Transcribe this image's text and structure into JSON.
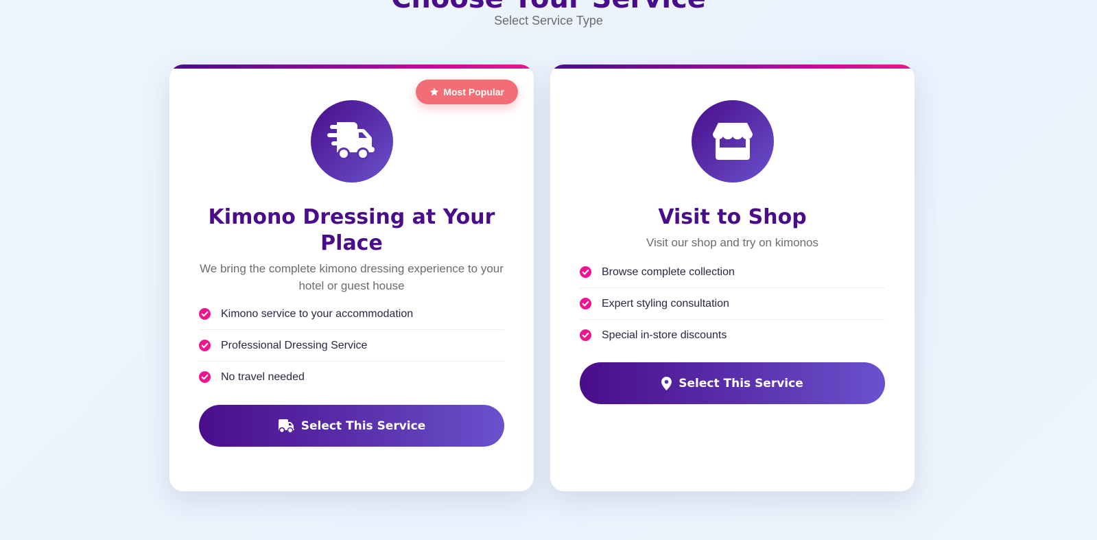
{
  "page": {
    "title": "Choose Your Service",
    "subtitle": "Select Service Type"
  },
  "colors": {
    "primary": "#4a0d8a",
    "accent_pink": "#f0158f",
    "badge": "#f26d75",
    "button_end": "#6a51cc"
  },
  "cards": [
    {
      "icon": "truck-fast-icon",
      "badge": "Most Popular",
      "badge_icon": "star-icon",
      "title": "Kimono Dressing at Your Place",
      "description": "We bring the complete kimono dressing experience to your hotel or guest house",
      "features": [
        "Kimono service to your accommodation",
        "Professional Dressing Service",
        "No travel needed"
      ],
      "button_label": "Select This Service",
      "button_icon": "truck-icon"
    },
    {
      "icon": "shop-icon",
      "title": "Visit to Shop",
      "description": "Visit our shop and try on kimonos",
      "features": [
        "Browse complete collection",
        "Expert styling consultation",
        "Special in-store discounts"
      ],
      "button_label": "Select This Service",
      "button_icon": "location-pin-icon"
    }
  ]
}
